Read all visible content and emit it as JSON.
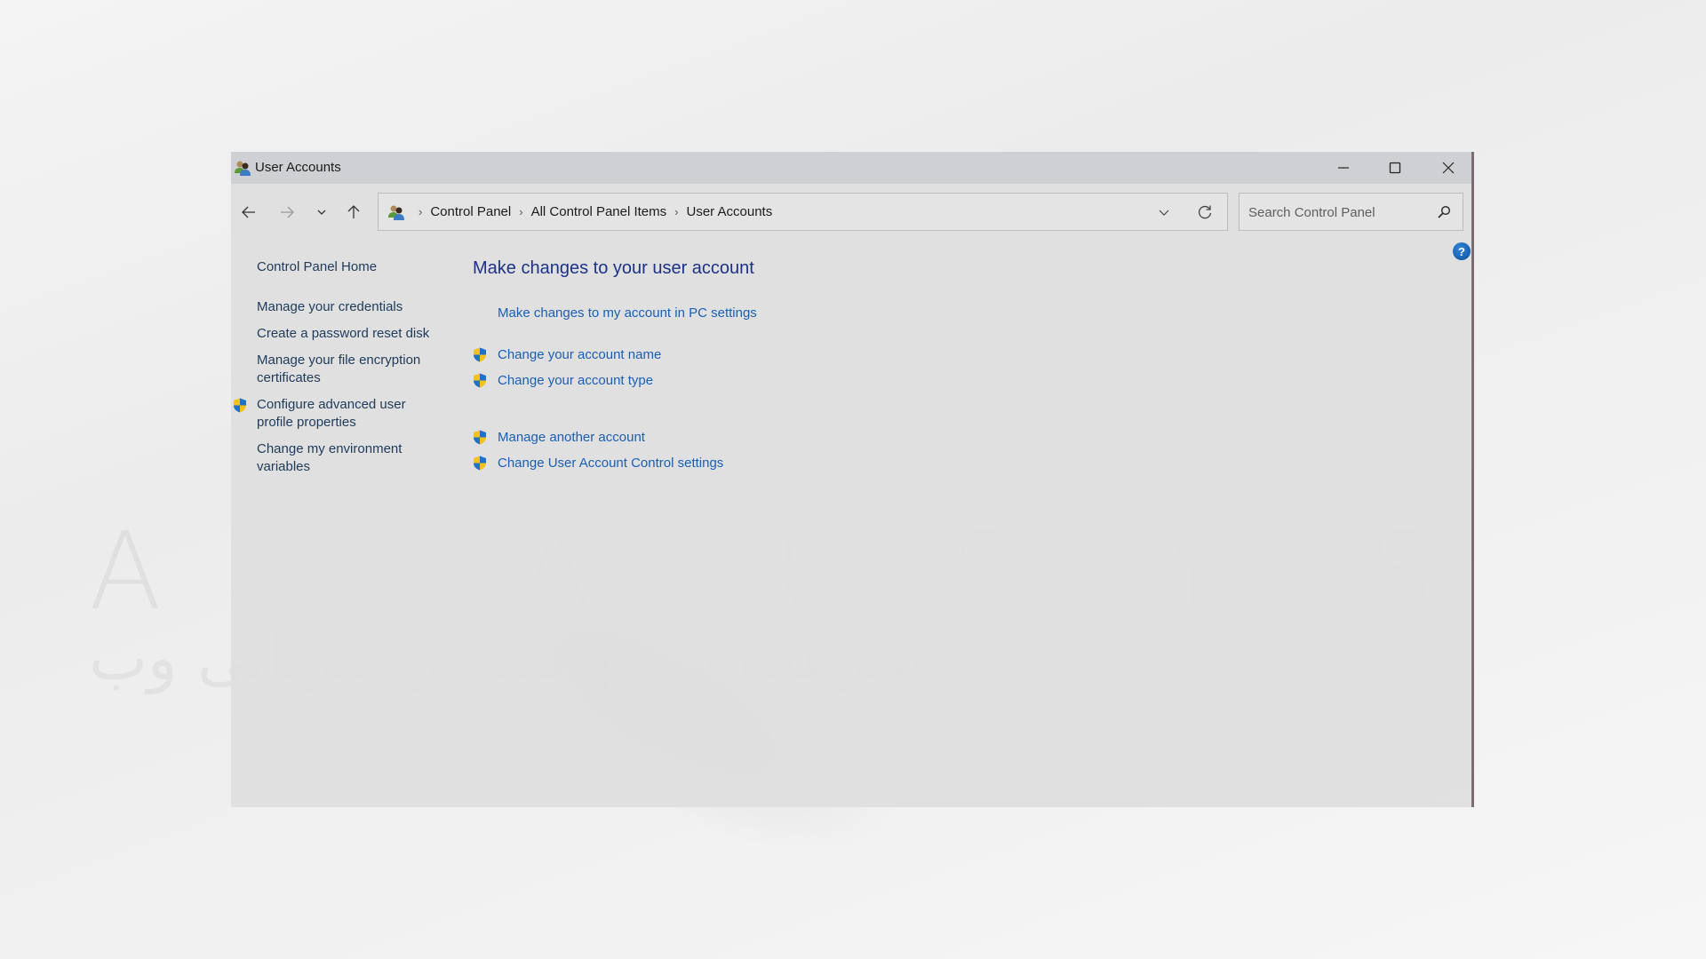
{
  "background": {
    "watermark_text": "AZARSYS",
    "watermark_subtext": "سرعت بی نهایت در میزبانی وب"
  },
  "window": {
    "title": "User Accounts",
    "title_icon": "user-accounts-icon",
    "controls": {
      "minimize": "minimize-icon",
      "maximize": "maximize-icon",
      "close": "close-icon"
    }
  },
  "navigation": {
    "back": "back-arrow-icon",
    "forward": "forward-arrow-icon",
    "recent": "chevron-down-icon",
    "up": "up-arrow-icon",
    "breadcrumb": [
      "Control Panel",
      "All Control Panel Items",
      "User Accounts"
    ],
    "search_placeholder": "Search Control Panel",
    "search_value": ""
  },
  "left_pane": {
    "items": [
      {
        "label": "Control Panel Home",
        "shield": false
      },
      {
        "label": "Manage your credentials",
        "shield": false
      },
      {
        "label": "Create a password reset disk",
        "shield": false
      },
      {
        "label": "Manage your file encryption certificates",
        "shield": false
      },
      {
        "label": "Configure advanced user profile properties",
        "shield": true
      },
      {
        "label": "Change my environment variables",
        "shield": false
      }
    ]
  },
  "main": {
    "heading": "Make changes to your user account",
    "links": [
      {
        "label": "Make changes to my account in PC settings",
        "shield": false
      },
      {
        "label": "Change your account name",
        "shield": true
      },
      {
        "label": "Change your account type",
        "shield": true
      },
      {
        "label": "Manage another account",
        "shield": true
      },
      {
        "label": "Change User Account Control settings",
        "shield": true
      }
    ]
  },
  "colors": {
    "heading": "#1c3287",
    "link": "#1a5fb4",
    "left_pane_text": "#1e3a5a",
    "shield_blue": "#1e73c8",
    "shield_yellow": "#f5c21b",
    "help_blue": "#1565c0"
  }
}
